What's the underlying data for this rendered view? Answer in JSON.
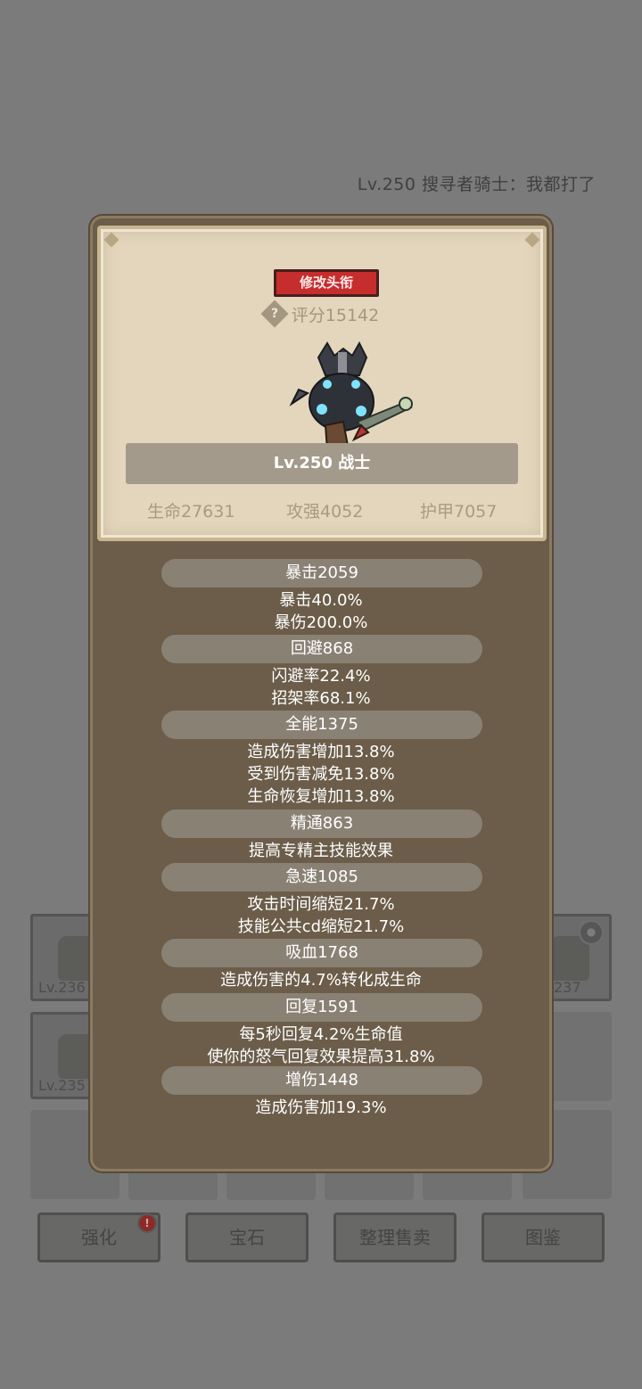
{
  "top_title": "Lv.250 搜寻者骑士：我都打了",
  "panel": {
    "title_button": "修改头衔",
    "help_icon": "?",
    "score": "评分15142",
    "name": "Lv.250 战士",
    "stats": {
      "life": "生命27631",
      "attack": "攻强4052",
      "armor": "护甲7057"
    }
  },
  "attributes": [
    {
      "header": "暴击2059",
      "lines": [
        "暴击40.0%",
        "暴伤200.0%"
      ]
    },
    {
      "header": "回避868",
      "lines": [
        "闪避率22.4%",
        "招架率68.1%"
      ]
    },
    {
      "header": "全能1375",
      "lines": [
        "造成伤害增加13.8%",
        "受到伤害减免13.8%",
        "生命恢复增加13.8%"
      ]
    },
    {
      "header": "精通863",
      "lines": [
        "提高专精主技能效果"
      ]
    },
    {
      "header": "急速1085",
      "lines": [
        "攻击时间缩短21.7%",
        "技能公共cd缩短21.7%"
      ]
    },
    {
      "header": "吸血1768",
      "lines": [
        "造成伤害的4.7%转化成生命"
      ]
    },
    {
      "header": "回复1591",
      "lines": [
        "每5秒回复4.2%生命值",
        "使你的怒气回复效果提高31.8%"
      ]
    },
    {
      "header": "增伤1448",
      "lines": [
        "造成伤害加19.3%"
      ]
    }
  ],
  "inventory": [
    {
      "level": "Lv.236"
    },
    {
      "level": "237"
    },
    {
      "level": "Lv.235"
    }
  ],
  "bottom_buttons": {
    "enhance": "强化",
    "gem": "宝石",
    "sell": "整理售卖",
    "codex": "图鉴"
  },
  "badge": "!",
  "colors": {
    "overlay_bg": "#7b7b7b",
    "panel_brown": "#6b5d49",
    "parchment": "#e3d6bd",
    "title_red": "#c62d2d",
    "attr_header": "#8a8175"
  }
}
